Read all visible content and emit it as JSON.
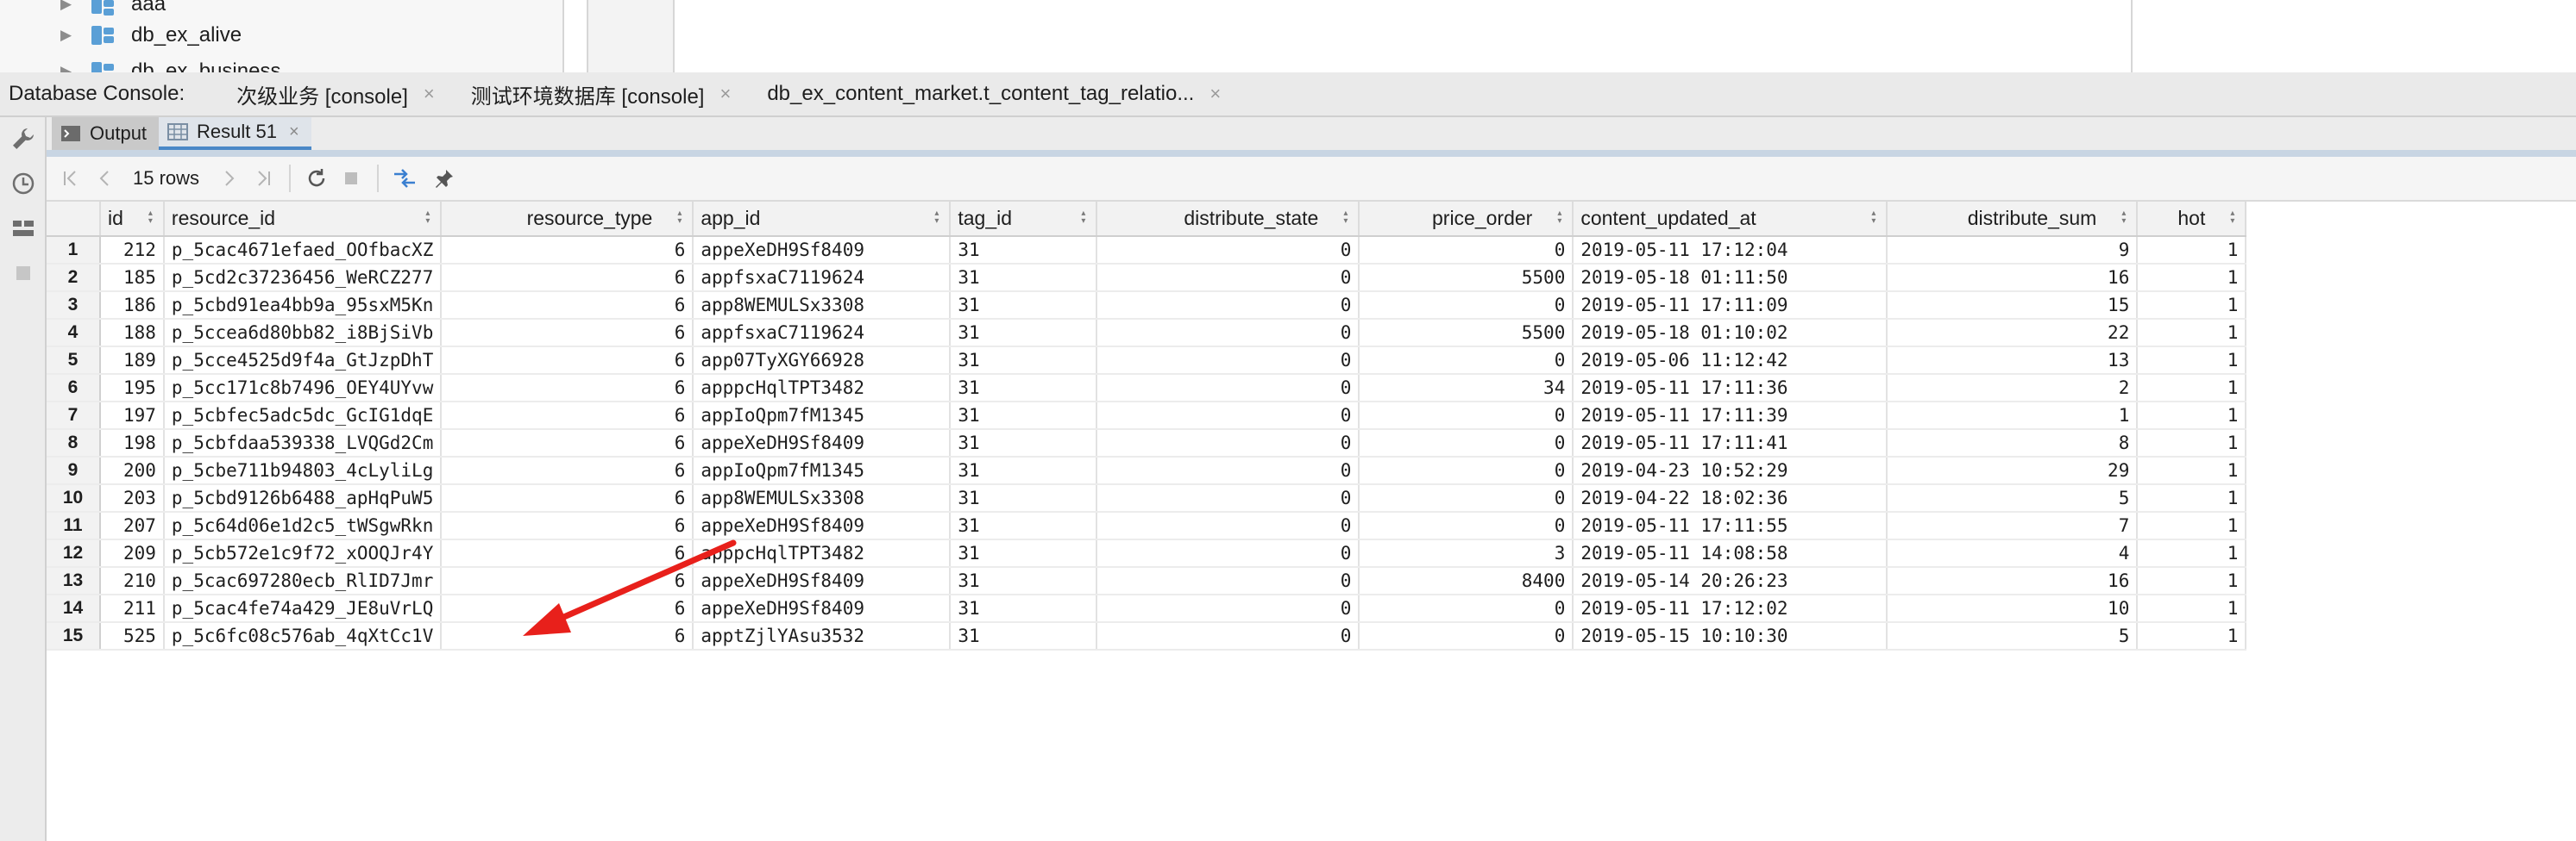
{
  "tree": {
    "items": [
      {
        "label": "aaa"
      },
      {
        "label": "db_ex_alive"
      },
      {
        "label": "db_ex_business"
      }
    ]
  },
  "console_bar": {
    "label": "Database Console:",
    "tabs": [
      {
        "label": "次级业务 [console]"
      },
      {
        "label": "测试环境数据库 [console]"
      },
      {
        "label": "db_ex_content_market.t_content_tag_relatio..."
      }
    ],
    "close_glyph": "×"
  },
  "result_tabs": {
    "output_label": "Output",
    "result_label": "Result 51"
  },
  "toolbar": {
    "rows_count": "15 rows"
  },
  "colors": {
    "accent": "#4a88c7",
    "arrow": "#e8201b"
  },
  "grid": {
    "columns": [
      "id",
      "resource_id",
      "resource_type",
      "app_id",
      "tag_id",
      "distribute_state",
      "price_order",
      "content_updated_at",
      "distribute_sum",
      "hot"
    ],
    "rows": [
      [
        "1",
        "212",
        "p_5cac4671efaed_OOfbacXZ",
        "6",
        "appeXeDH9Sf8409",
        "31",
        "0",
        "0",
        "2019-05-11 17:12:04",
        "9",
        "1"
      ],
      [
        "2",
        "185",
        "p_5cd2c37236456_WeRCZ277",
        "6",
        "appfsxaC7119624",
        "31",
        "0",
        "5500",
        "2019-05-18 01:11:50",
        "16",
        "1"
      ],
      [
        "3",
        "186",
        "p_5cbd91ea4bb9a_95sxM5Kn",
        "6",
        "app8WEMULSx3308",
        "31",
        "0",
        "0",
        "2019-05-11 17:11:09",
        "15",
        "1"
      ],
      [
        "4",
        "188",
        "p_5ccea6d80bb82_i8BjSiVb",
        "6",
        "appfsxaC7119624",
        "31",
        "0",
        "5500",
        "2019-05-18 01:10:02",
        "22",
        "1"
      ],
      [
        "5",
        "189",
        "p_5cce4525d9f4a_GtJzpDhT",
        "6",
        "app07TyXGY66928",
        "31",
        "0",
        "0",
        "2019-05-06 11:12:42",
        "13",
        "1"
      ],
      [
        "6",
        "195",
        "p_5cc171c8b7496_OEY4UYvw",
        "6",
        "apppcHqlTPT3482",
        "31",
        "0",
        "34",
        "2019-05-11 17:11:36",
        "2",
        "1"
      ],
      [
        "7",
        "197",
        "p_5cbfec5adc5dc_GcIG1dqE",
        "6",
        "appIoQpm7fM1345",
        "31",
        "0",
        "0",
        "2019-05-11 17:11:39",
        "1",
        "1"
      ],
      [
        "8",
        "198",
        "p_5cbfdaa539338_LVQGd2Cm",
        "6",
        "appeXeDH9Sf8409",
        "31",
        "0",
        "0",
        "2019-05-11 17:11:41",
        "8",
        "1"
      ],
      [
        "9",
        "200",
        "p_5cbe711b94803_4cLyliLg",
        "6",
        "appIoQpm7fM1345",
        "31",
        "0",
        "0",
        "2019-04-23 10:52:29",
        "29",
        "1"
      ],
      [
        "10",
        "203",
        "p_5cbd9126b6488_apHqPuW5",
        "6",
        "app8WEMULSx3308",
        "31",
        "0",
        "0",
        "2019-04-22 18:02:36",
        "5",
        "1"
      ],
      [
        "11",
        "207",
        "p_5c64d06e1d2c5_tWSgwRkn",
        "6",
        "appeXeDH9Sf8409",
        "31",
        "0",
        "0",
        "2019-05-11 17:11:55",
        "7",
        "1"
      ],
      [
        "12",
        "209",
        "p_5cb572e1c9f72_xOOQJr4Y",
        "6",
        "apppcHqlTPT3482",
        "31",
        "0",
        "3",
        "2019-05-11 14:08:58",
        "4",
        "1"
      ],
      [
        "13",
        "210",
        "p_5cac697280ecb_RlID7Jmr",
        "6",
        "appeXeDH9Sf8409",
        "31",
        "0",
        "8400",
        "2019-05-14 20:26:23",
        "16",
        "1"
      ],
      [
        "14",
        "211",
        "p_5cac4fe74a429_JE8uVrLQ",
        "6",
        "appeXeDH9Sf8409",
        "31",
        "0",
        "0",
        "2019-05-11 17:12:02",
        "10",
        "1"
      ],
      [
        "15",
        "525",
        "p_5c6fc08c576ab_4qXtCc1V",
        "6",
        "apptZjlYAsu3532",
        "31",
        "0",
        "0",
        "2019-05-15 10:10:30",
        "5",
        "1"
      ]
    ]
  }
}
